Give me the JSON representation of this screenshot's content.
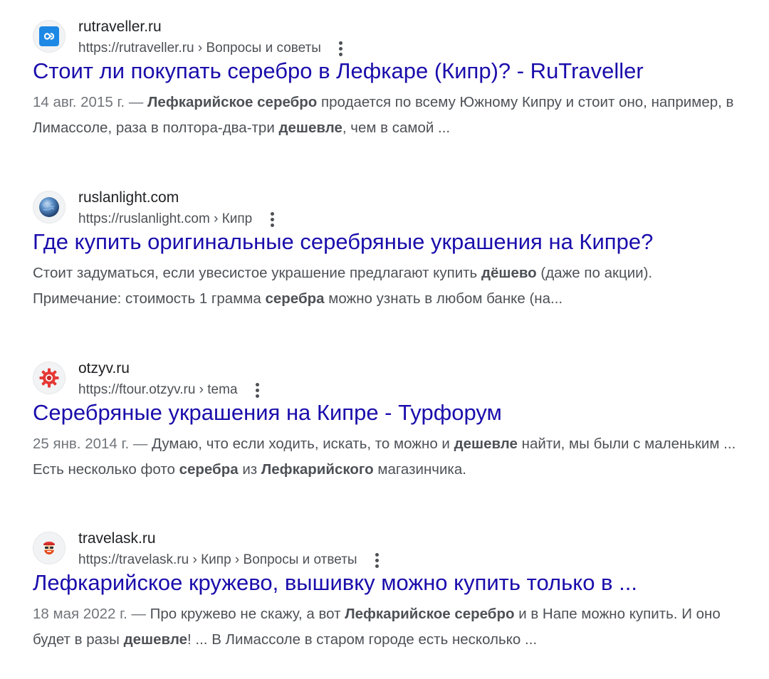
{
  "results": [
    {
      "site_name": "rutraveller.ru",
      "url": "https://rutraveller.ru › Вопросы и советы",
      "favicon": "infinity-icon",
      "title": "Стоит ли покупать серебро в Лефкаре (Кипр)? - RuTraveller",
      "date": "14 авг. 2015 г. — ",
      "snippet": [
        {
          "t": "Лефкарийское серебро",
          "b": true
        },
        {
          "t": " продается по всему Южному Кипру и стоит оно, например, в Лимассоле, раза в полтора-два-три ",
          "b": false
        },
        {
          "t": "дешевле",
          "b": true
        },
        {
          "t": ", чем в самой ...",
          "b": false
        }
      ]
    },
    {
      "site_name": "ruslanlight.com",
      "url": "https://ruslanlight.com › Кипр",
      "favicon": "globe-icon",
      "title": "Где купить оригинальные серебряные украшения на Кипре?",
      "date": "",
      "snippet": [
        {
          "t": "Стоит задуматься, если увесистое украшение предлагают купить ",
          "b": false
        },
        {
          "t": "дёшево",
          "b": true
        },
        {
          "t": " (даже по акции). Примечание: стоимость 1 грамма ",
          "b": false
        },
        {
          "t": "серебра",
          "b": true
        },
        {
          "t": " можно узнать в любом банке (на...",
          "b": false
        }
      ]
    },
    {
      "site_name": "otzyv.ru",
      "url": "https://ftour.otzyv.ru › tema",
      "favicon": "gear-icon",
      "title": "Серебряные украшения на Кипре - Турфорум",
      "date": "25 янв. 2014 г. — ",
      "snippet": [
        {
          "t": "Думаю, что если ходить, искать, то можно и ",
          "b": false
        },
        {
          "t": "дешевле",
          "b": true
        },
        {
          "t": " найти, мы были с маленьким ... Есть несколько фото ",
          "b": false
        },
        {
          "t": "серебра",
          "b": true
        },
        {
          "t": " из ",
          "b": false
        },
        {
          "t": "Лефкарийского",
          "b": true
        },
        {
          "t": " магазинчика.",
          "b": false
        }
      ]
    },
    {
      "site_name": "travelask.ru",
      "url": "https://travelask.ru › Кипр › Вопросы и ответы",
      "favicon": "traveler-avatar-icon",
      "title": "Лефкарийское кружево, вышивку можно купить только в ...",
      "date": "18 мая 2022 г. — ",
      "snippet": [
        {
          "t": "Про кружево не скажу, а вот ",
          "b": false
        },
        {
          "t": "Лефкарийское серебро",
          "b": true
        },
        {
          "t": " и в Напе можно купить. И оно будет в разы ",
          "b": false
        },
        {
          "t": "дешевле",
          "b": true
        },
        {
          "t": "! ... В Лимассоле в старом городе есть несколько ...",
          "b": false
        }
      ]
    }
  ]
}
